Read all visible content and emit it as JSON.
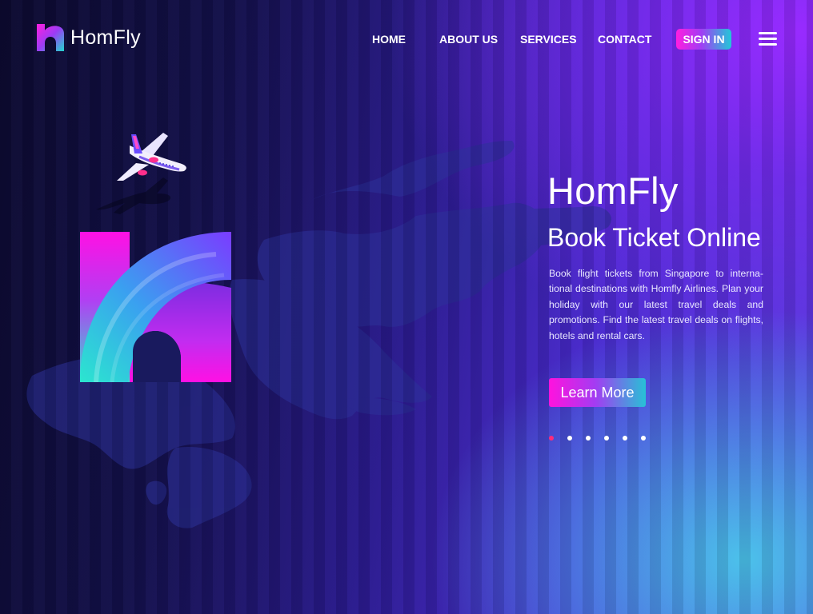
{
  "brand": {
    "name": "HomFly"
  },
  "nav": {
    "items": [
      {
        "label": "HOME"
      },
      {
        "label": "ABOUT US"
      },
      {
        "label": "SERVICES"
      },
      {
        "label": "CONTACT"
      }
    ],
    "signin_label": "SIGN IN",
    "menu_icon": "hamburger-icon"
  },
  "hero": {
    "title": "HomFly",
    "subtitle": "Book Ticket Online",
    "description": "Book flight tickets from Singapore to interna-tional destinations with Homfly Airlines. Plan your holiday with our latest travel deals and promotions. Find the latest travel deals on flights, hotels and rental cars.",
    "cta_label": "Learn More"
  },
  "slider": {
    "total": 6,
    "active": 1
  },
  "illustration": {
    "plane_icon": "airplane-icon",
    "logo_mark": "homfly-logo-mark",
    "background": "world-map"
  },
  "colors": {
    "accent_pink": "#ff12de",
    "accent_purple": "#a33cf2",
    "accent_cyan": "#27c1d6",
    "active_dot": "#ff2a7a",
    "background_dark": "#0c0a30",
    "background_purple": "#7a2cff",
    "background_blue": "#48c8eb"
  }
}
